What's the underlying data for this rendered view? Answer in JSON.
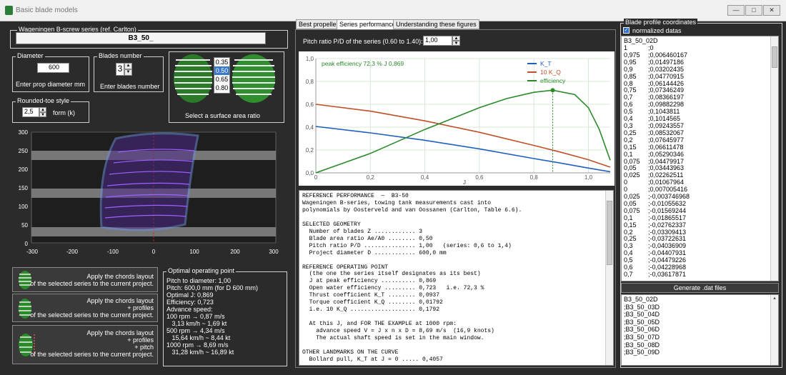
{
  "window": {
    "title": "Basic blade models",
    "min_glyph": "—",
    "max_glyph": "□",
    "close_glyph": "✕"
  },
  "series": {
    "group_label": "Wageningen B-screw series (ref. Carlton)",
    "name": "B3_50_"
  },
  "diameter": {
    "group_label": "Diameter",
    "value": "600",
    "caption": "Enter prop diameter mm"
  },
  "blades": {
    "group_label": "Blades number",
    "value": "3",
    "caption": "Enter blades number"
  },
  "area_ratio": {
    "options": [
      "0.35",
      "0.50",
      "0.65",
      "0.80"
    ],
    "selected": "0.50",
    "caption": "Select a surface area ratio"
  },
  "rounded_toe": {
    "group_label": "Rounded-toe style",
    "value": "2,5",
    "caption": "form (k)"
  },
  "blade_plot": {
    "y_ticks": [
      "300",
      "250",
      "200",
      "150",
      "100",
      "50",
      "0"
    ],
    "x_ticks": [
      "-300",
      "-200",
      "-100",
      "0",
      "100",
      "200",
      "300"
    ]
  },
  "apply_buttons": [
    {
      "lines": [
        "Apply the chords layout",
        "of the selected series to the current project."
      ]
    },
    {
      "lines": [
        "Apply the chords layout",
        "+ profiles",
        "of the selected series to the current project."
      ]
    },
    {
      "lines": [
        "Apply the chords layout",
        "+ profiles",
        "+ pitch",
        "of the selected series to the current project."
      ]
    }
  ],
  "operating_point": {
    "group_label": "Optimal operating point",
    "lines": [
      "Pitch to diameter: 1,00",
      "Pitch: 600,0 mm (for D 600 mm)",
      "Optimal J: 0,869",
      "Efficiency: 0,723",
      "Advance speed:",
      "100 rpm → 0,87 m/s",
      "   3,13 km/h ~ 1,69 kt",
      "500 rpm → 4,34 m/s",
      "   15,64 km/h ~ 8,44 kt",
      "1000 rpm → 8,69 m/s",
      "   31,28 km/h ~ 16,89 kt"
    ]
  },
  "tabs": [
    "Best propeller",
    "Series performance",
    "Understanding these figures"
  ],
  "active_tab": "Series performance",
  "pitch_ratio": {
    "label": "Pitch ratio P/D of the series (0.60 to 1.40):",
    "value": "1,00"
  },
  "chart_data": {
    "type": "line",
    "xlabel": "J",
    "ylabel": "",
    "xlim": [
      0,
      1.08
    ],
    "ylim": [
      0,
      1.0
    ],
    "x_ticks": [
      0,
      0.2,
      0.4,
      0.6,
      0.8,
      1.0
    ],
    "x_tick_labels": [
      "0",
      "0,2",
      "0,4",
      "0,6",
      "0,8",
      "1,0"
    ],
    "y_ticks": [
      0,
      0.2,
      0.4,
      0.6,
      0.8,
      1.0
    ],
    "y_tick_labels": [
      "0,0",
      "0,2",
      "0,4",
      "0,6",
      "0,8",
      "1,0"
    ],
    "grid": true,
    "legend_position": "top-right",
    "annotation": "peak efficiency 72,3 %   J 0,869",
    "peak": {
      "x": 0.869,
      "y": 0.723
    },
    "series": [
      {
        "name": "K_T",
        "color": "#1f5fbf",
        "x": [
          0,
          0.2,
          0.4,
          0.6,
          0.8,
          0.9,
          1.0,
          1.08
        ],
        "y": [
          0.406,
          0.35,
          0.285,
          0.21,
          0.125,
          0.085,
          0.042,
          0.01
        ]
      },
      {
        "name": "10 K_Q",
        "color": "#c0502a",
        "x": [
          0,
          0.2,
          0.4,
          0.6,
          0.8,
          0.9,
          1.0,
          1.08
        ],
        "y": [
          0.6,
          0.54,
          0.455,
          0.355,
          0.24,
          0.18,
          0.115,
          0.05
        ]
      },
      {
        "name": "efficiency",
        "color": "#2a8a2a",
        "x": [
          0,
          0.2,
          0.4,
          0.6,
          0.7,
          0.8,
          0.869,
          0.95,
          1.0,
          1.04,
          1.08
        ],
        "y": [
          0,
          0.17,
          0.38,
          0.57,
          0.65,
          0.705,
          0.723,
          0.685,
          0.57,
          0.38,
          0.11
        ]
      }
    ]
  },
  "report_lines": [
    "REFERENCE PERFORMANCE  —  B3-50",
    "Wageningen B-series, towing tank measurements cast into",
    "polynomials by Oosterveld and van Oossanen (Carlton, Table 6.6).",
    "",
    "SELECTED GEOMETRY",
    "  Number of blades Z ............ 3",
    "  Blade area ratio Ae/A0 ........ 0,50",
    "  Pitch ratio P/D ............... 1,00   (series: 0,6 to 1,4)",
    "  Project diameter D ............ 600,0 mm",
    "",
    "REFERENCE OPERATING POINT",
    "  (the one the series itself designates as its best)",
    "  J at peak efficiency .......... 0,869",
    "  Open water efficiency ......... 0,723   i.e. 72,3 %",
    "  Thrust coefficient K_T ........ 0,0937",
    "  Torque coefficient K_Q ........ 0,01792",
    "  i.e. 10 K_Q ................... 0,1792",
    "",
    "  At this J, and FOR THE EXAMPLE at 1000 rpm:",
    "    advance speed V = J x n x D = 8,69 m/s  (16,9 knots)",
    "    The actual shaft speed is set in the main window.",
    "",
    "OTHER LANDMARKS ON THE CURVE",
    "  Bollard pull, K_T at J = 0 ..... 0,4057"
  ],
  "profile": {
    "group_label": "Blade profile coordinates",
    "checkbox_label": "normalized datas",
    "checked": true,
    "header": "B3_50_02D",
    "rows": [
      [
        "1",
        "0"
      ],
      [
        "0,975",
        "0,006460167"
      ],
      [
        "0,95",
        "0,01497186"
      ],
      [
        "0,9",
        "0,03202435"
      ],
      [
        "0,85",
        "0,04770915"
      ],
      [
        "0,8",
        "0,06144426"
      ],
      [
        "0,75",
        "0,07346249"
      ],
      [
        "0,7",
        "0,08366197"
      ],
      [
        "0,6",
        "0,09882298"
      ],
      [
        "0,5",
        "0,1043811"
      ],
      [
        "0,4",
        "0,1014565"
      ],
      [
        "0,3",
        "0,09243557"
      ],
      [
        "0,25",
        "0,08532067"
      ],
      [
        "0,2",
        "0,07645977"
      ],
      [
        "0,15",
        "0,06611478"
      ],
      [
        "0,1",
        "0,05290346"
      ],
      [
        "0,075",
        "0,04479917"
      ],
      [
        "0,05",
        "0,03443963"
      ],
      [
        "0,025",
        "0,02262511"
      ],
      [
        "0",
        "0,01067964"
      ],
      [
        "0",
        "0,007005416"
      ],
      [
        "0,025",
        "-0,003746968"
      ],
      [
        "0,05",
        "-0,01055632"
      ],
      [
        "0,075",
        "-0,01569244"
      ],
      [
        "0,1",
        "-0,01865517"
      ],
      [
        "0,15",
        "-0,02762337"
      ],
      [
        "0,2",
        "-0,03309413"
      ],
      [
        "0,25",
        "-0,03722631"
      ],
      [
        "0,3",
        "-0,04036909"
      ],
      [
        "0,4",
        "-0,04407931"
      ],
      [
        "0,5",
        "-0,04479226"
      ],
      [
        "0,6",
        "-0,04228968"
      ],
      [
        "0,7",
        "-0,03617871"
      ]
    ],
    "generate_label": "Generate .dat files",
    "files": [
      "B3_50_02D",
      ";B3_50_03D",
      ";B3_50_04D",
      ";B3_50_05D",
      ";B3_50_06D",
      ";B3_50_07D",
      ";B3_50_08D",
      ";B3_50_09D"
    ]
  }
}
